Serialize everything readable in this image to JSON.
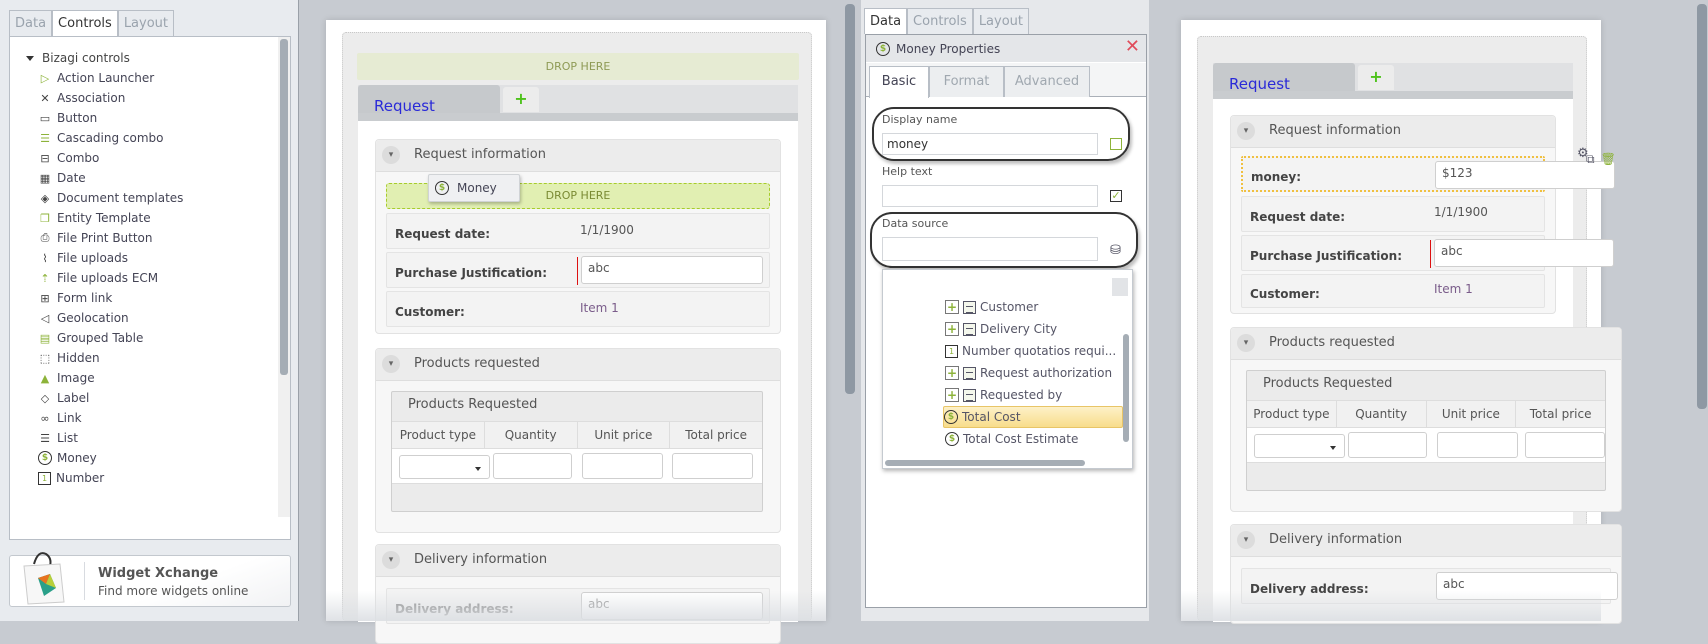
{
  "sidebar": {
    "tabs": [
      {
        "label": "Data"
      },
      {
        "label": "Controls"
      },
      {
        "label": "Layout"
      }
    ],
    "active_tab": "Controls",
    "tree_root": "Bizagi controls",
    "controls": [
      {
        "label": "Action Launcher",
        "icon": "play-icon"
      },
      {
        "label": "Association",
        "icon": "association-icon"
      },
      {
        "label": "Button",
        "icon": "button-icon"
      },
      {
        "label": "Cascading combo",
        "icon": "cascading-combo-icon"
      },
      {
        "label": "Combo",
        "icon": "combo-icon"
      },
      {
        "label": "Date",
        "icon": "calendar-icon"
      },
      {
        "label": "Document templates",
        "icon": "document-templates-icon"
      },
      {
        "label": "Entity Template",
        "icon": "entity-template-icon"
      },
      {
        "label": "File Print Button",
        "icon": "printer-icon"
      },
      {
        "label": "File uploads",
        "icon": "paperclip-icon"
      },
      {
        "label": "File uploads ECM",
        "icon": "upload-icon"
      },
      {
        "label": "Form link",
        "icon": "form-link-icon"
      },
      {
        "label": "Geolocation",
        "icon": "location-arrow-icon"
      },
      {
        "label": "Grouped Table",
        "icon": "grouped-table-icon"
      },
      {
        "label": "Hidden",
        "icon": "hidden-icon"
      },
      {
        "label": "Image",
        "icon": "image-icon"
      },
      {
        "label": "Label",
        "icon": "tag-icon"
      },
      {
        "label": "Link",
        "icon": "link-icon"
      },
      {
        "label": "List",
        "icon": "list-icon"
      },
      {
        "label": "Money",
        "icon": "money-icon"
      },
      {
        "label": "Number",
        "icon": "number-icon"
      }
    ],
    "widget": {
      "title": "Widget Xchange",
      "subtitle": "Find more widgets online"
    }
  },
  "form_left": {
    "drop_top": "DROP HERE",
    "tab_label": "Request",
    "add_tab": "+",
    "group_request": {
      "title": "Request information",
      "drop_here": "DROP HERE",
      "drag_chip": "Money",
      "rows": [
        {
          "label": "Request date:",
          "value": "1/1/1900"
        },
        {
          "label": "Purchase Justification:",
          "value": "abc"
        },
        {
          "label": "Customer:",
          "value": "Item 1"
        }
      ]
    },
    "group_products": {
      "title": "Products requested",
      "grid_title": "Products Requested",
      "columns": [
        "Product type",
        "Quantity",
        "Unit price",
        "Total price"
      ]
    },
    "group_delivery": {
      "title": "Delivery information",
      "rows": [
        {
          "label": "Delivery address:",
          "value": "abc"
        }
      ]
    }
  },
  "props": {
    "tabs": [
      {
        "label": "Data"
      },
      {
        "label": "Controls"
      },
      {
        "label": "Layout"
      }
    ],
    "active_tab": "Data",
    "title": "Money Properties",
    "subtabs": [
      {
        "label": "Basic"
      },
      {
        "label": "Format"
      },
      {
        "label": "Advanced"
      }
    ],
    "active_subtab": "Basic",
    "display_name_label": "Display name",
    "display_name_value": "money",
    "help_text_label": "Help text",
    "help_text_value": "",
    "data_source_label": "Data source",
    "data_source_value": "",
    "data_source_items": [
      {
        "label": "Customer",
        "type": "entity",
        "expandable": true
      },
      {
        "label": "Delivery City",
        "type": "entity",
        "expandable": true
      },
      {
        "label": "Number quotatios requi...",
        "type": "number",
        "expandable": false
      },
      {
        "label": "Request authorization",
        "type": "entity",
        "expandable": true
      },
      {
        "label": "Requested by",
        "type": "table",
        "expandable": true
      },
      {
        "label": "Total Cost",
        "type": "money",
        "expandable": false,
        "selected": true
      },
      {
        "label": "Total Cost Estimate",
        "type": "money",
        "expandable": false
      }
    ]
  },
  "form_right": {
    "tab_label": "Request",
    "add_tab": "+",
    "group_request": {
      "title": "Request information",
      "rows": [
        {
          "label": "money:",
          "value": "$123"
        },
        {
          "label": "Request date:",
          "value": "1/1/1900"
        },
        {
          "label": "Purchase Justification:",
          "value": "abc"
        },
        {
          "label": "Customer:",
          "value": "Item 1"
        }
      ]
    },
    "group_products": {
      "title": "Products requested",
      "grid_title": "Products Requested",
      "columns": [
        "Product type",
        "Quantity",
        "Unit price",
        "Total price"
      ]
    },
    "group_delivery": {
      "title": "Delivery information",
      "rows": [
        {
          "label": "Delivery address:",
          "value": "abc"
        }
      ]
    }
  },
  "colors": {
    "accent_green": "#8db33a",
    "tab_link_blue": "#2a2ad8",
    "drop_zone": "#e1efb2",
    "selected_item": "#f8dd8b",
    "close_red": "#e04b5a"
  }
}
